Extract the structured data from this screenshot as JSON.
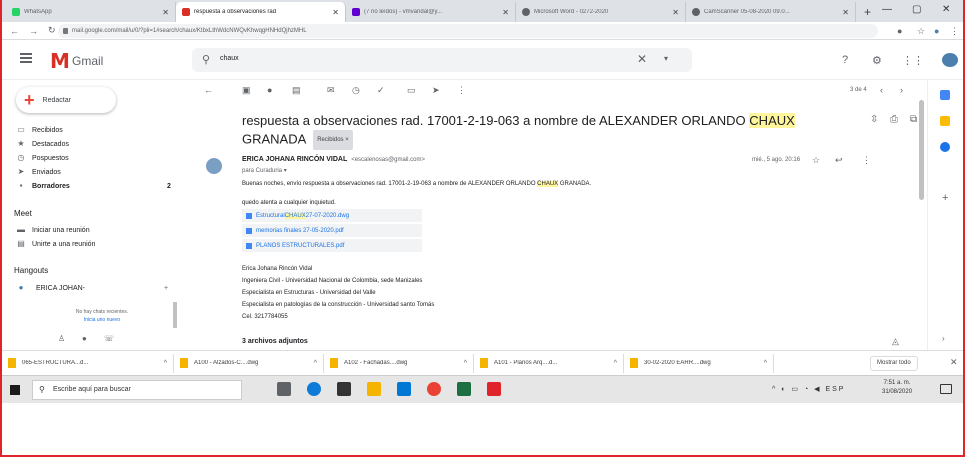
{
  "browser": {
    "tabs": [
      {
        "label": "WhatsApp",
        "color": "#25d366"
      },
      {
        "label": "respuesta a observaciones rad",
        "color": "#d93025"
      },
      {
        "label": "(7 no leídos) - vmvandal@y...",
        "color": "#6001d2"
      },
      {
        "label": "Microsoft Word - 0272-2020",
        "color": "#5f6368"
      },
      {
        "label": "CamScanner 05-08-2020 09.0...",
        "color": "#5f6368"
      }
    ],
    "url": "mail.google.com/mail/u/0/?pli=1#search/chaux/KtbxLthWdcNWQvKhwqgHNHdQjhzMHL"
  },
  "gmail": {
    "logo_text": "Gmail",
    "search_query": "chaux",
    "compose_label": "Redactar",
    "nav": [
      {
        "icon": "inbox-icon",
        "label": "Recibidos",
        "count": ""
      },
      {
        "icon": "star-icon",
        "label": "Destacados",
        "count": ""
      },
      {
        "icon": "clock-icon",
        "label": "Pospuestos",
        "count": ""
      },
      {
        "icon": "send-icon",
        "label": "Enviados",
        "count": ""
      },
      {
        "icon": "draft-icon",
        "label": "Borradores",
        "count": "2"
      }
    ],
    "meet": {
      "title": "Meet",
      "items": [
        "Iniciar una reunión",
        "Unirte a una reunión"
      ]
    },
    "hangouts": {
      "title": "Hangouts",
      "user": "ERICA JOHAN-",
      "empty_line1": "No hay chats recientes.",
      "empty_link": "Inicia uno nuevo"
    },
    "pager": "3 de 4",
    "subject_part1": "respuesta a observaciones rad. 17001-2-19-063 a nombre de ALEXANDER ORLANDO",
    "subject_highlight": "CHAUX",
    "subject_part2": "GRANADA",
    "label_chip": "Recibidos ×",
    "sender_name": "ERICA JOHANA RINCÓN VIDAL",
    "sender_email": "<escalenosas@gmail.com>",
    "to_line": "para Curaduria ▾",
    "date": "mié., 5 ago. 20:16",
    "body_intro_a": "Buenas noches, envío respuesta a observaciones rad. 17001-2-19-063 a nombre de ALEXANDER ORLANDO ",
    "body_intro_hl": "CHAUX",
    "body_intro_b": " GRANADA.",
    "body_waiting": "quedo atenta a cualquier inquietud.",
    "attachments": [
      {
        "pre": "Estructural ",
        "hl": "CHAUX",
        "post": " 27-07-2020.dwg"
      },
      {
        "pre": "memorias finales 27-05-2020.pdf",
        "hl": "",
        "post": ""
      },
      {
        "pre": "PLANOS ESTRUCTURALES.pdf",
        "hl": "",
        "post": ""
      }
    ],
    "signature": [
      "Erica Johana Rincón Vidal",
      "Ingeniera Civil - Universidad Nacional de Colombia, sede Manizales",
      "Especialista en Estructuras - Universidad del Valle",
      "Especialista en patologías de la construcción - Universidad santo Tomás",
      "Cel. 3217784055"
    ],
    "attach_count": "3 archivos adjuntos"
  },
  "downloads": {
    "items": [
      "065-ESTRUCTURA...d...",
      "A100 - Alzados-C....dwg",
      "A102 - Fachadas....dwg",
      "A101 - Planos Arq....d...",
      "30-02-2020 EARR....dwg"
    ],
    "show_all": "Mostrar todo"
  },
  "taskbar": {
    "search_placeholder": "Escribe aquí para buscar",
    "tray": "ESP",
    "time": "7:51 a. m.",
    "date": "31/08/2020"
  }
}
